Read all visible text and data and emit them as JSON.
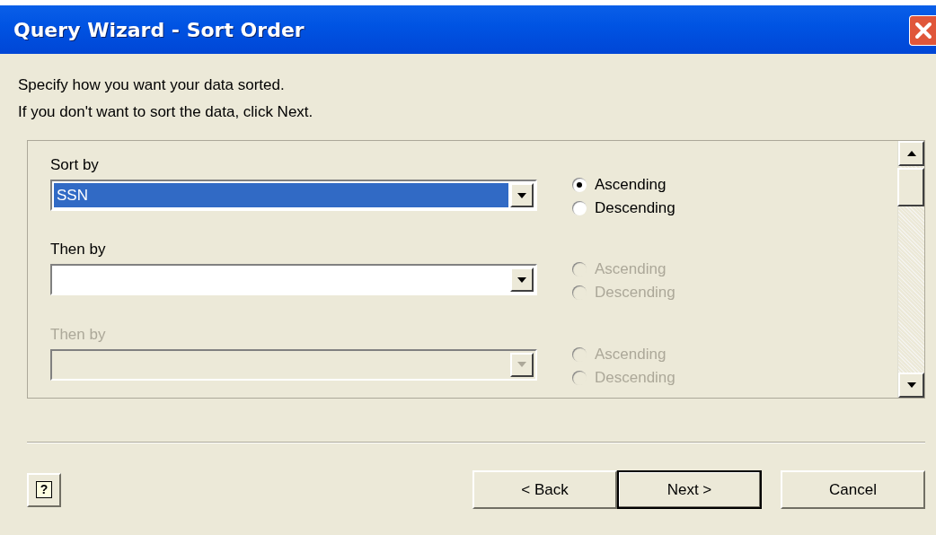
{
  "window": {
    "title": "Query Wizard - Sort Order"
  },
  "instructions": [
    "Specify how you want your data sorted.",
    "If you don't want to sort the data, click Next."
  ],
  "sort_levels": [
    {
      "label": "Sort by",
      "value": "SSN",
      "highlighted": true,
      "disabled": false,
      "options": [
        {
          "label": "Ascending",
          "selected": true,
          "disabled": false
        },
        {
          "label": "Descending",
          "selected": false,
          "disabled": false
        }
      ]
    },
    {
      "label": "Then by",
      "highlighted": false,
      "disabled": false,
      "options": [
        {
          "label": "Ascending",
          "selected": false,
          "disabled": true
        },
        {
          "label": "Descending",
          "selected": false,
          "disabled": true
        }
      ]
    },
    {
      "label": "Then by",
      "highlighted": false,
      "disabled": true,
      "options": [
        {
          "label": "Ascending",
          "selected": false,
          "disabled": true
        },
        {
          "label": "Descending",
          "selected": false,
          "disabled": true
        }
      ]
    }
  ],
  "help_button": {
    "glyph": "?"
  },
  "buttons": [
    {
      "label": "< Back",
      "default": false
    },
    {
      "label": "Next >",
      "default": true
    },
    {
      "label": "Cancel",
      "default": false
    }
  ]
}
